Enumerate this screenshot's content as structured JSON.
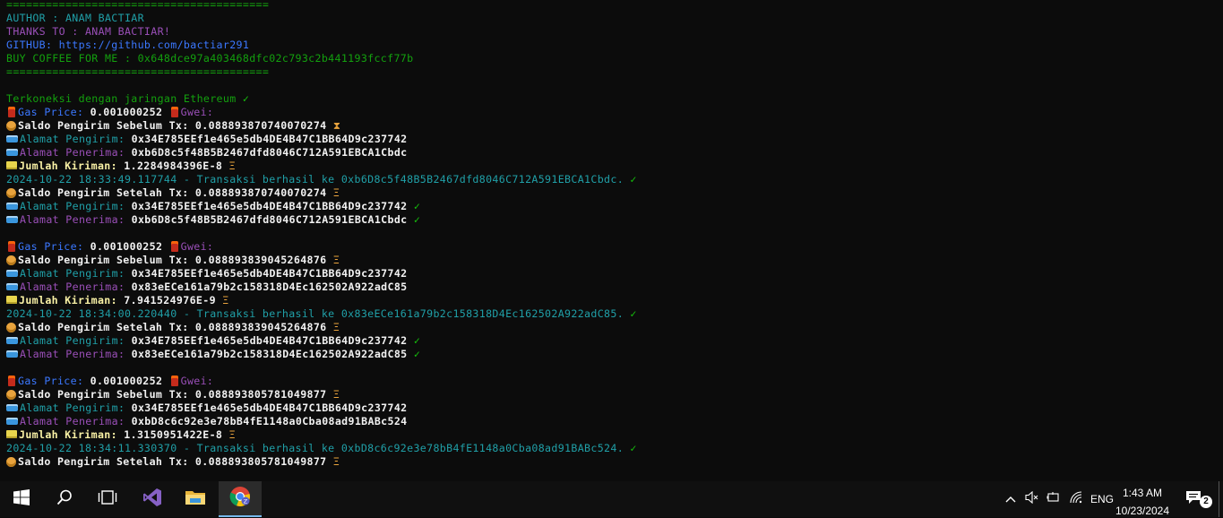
{
  "terminal": {
    "lines": [
      [
        {
          "t": "========================================",
          "c": "c-green"
        }
      ],
      [
        {
          "t": "AUTHOR : ANAM BACTIAR",
          "c": "c-teal"
        }
      ],
      [
        {
          "t": "THANKS TO : ANAM BACTIAR!",
          "c": "c-magenta"
        }
      ],
      [
        {
          "t": "GITHUB: https://github.com/bactiar291",
          "c": "c-blue"
        }
      ],
      [
        {
          "t": "BUY COFFEE FOR ME : 0x648dce97a403468dfc02c793c2b441193fccf77b",
          "c": "c-green"
        }
      ],
      [
        {
          "t": "========================================",
          "c": "c-green"
        }
      ],
      [],
      [
        {
          "t": "Terkoneksi dengan jaringan Ethereum ",
          "c": "c-green"
        },
        {
          "t": "✓",
          "c": "c-check"
        }
      ],
      [
        {
          "icon": "gas"
        },
        {
          "t": "Gas Price: ",
          "c": "c-blue"
        },
        {
          "t": "0.001000252 ",
          "c": "c-white"
        },
        {
          "icon": "gas"
        },
        {
          "t": "Gwei:",
          "c": "c-magenta"
        }
      ],
      [
        {
          "icon": "money"
        },
        {
          "t": "Saldo Pengirim Sebelum Tx: 0.088893870740070274 ",
          "c": "c-white"
        },
        {
          "t": "⧗",
          "c": "c-hour"
        }
      ],
      [
        {
          "icon": "wallet"
        },
        {
          "t": "Alamat Pengirim: ",
          "c": "c-teal"
        },
        {
          "t": "0x34E785EEf1e465e5db4DE4B47C1BB64D9c237742",
          "c": "c-white"
        }
      ],
      [
        {
          "icon": "wallet"
        },
        {
          "t": "Alamat Penerima: ",
          "c": "c-magenta"
        },
        {
          "t": "0xb6D8c5f48B5B2467dfd8046C712A591EBCA1Cbdc",
          "c": "c-white"
        }
      ],
      [
        {
          "icon": "sum"
        },
        {
          "t": "Jumlah Kiriman: ",
          "c": "c-yellow"
        },
        {
          "t": "1.2284984396E-8 ",
          "c": "c-white"
        },
        {
          "t": "Ξ",
          "c": "c-hour"
        }
      ],
      [
        {
          "t": "2024-10-22 18:33:49.117744 - Transaksi berhasil ke 0xb6D8c5f48B5B2467dfd8046C712A591EBCA1Cbdc. ",
          "c": "c-teal"
        },
        {
          "t": "✓",
          "c": "c-check"
        }
      ],
      [
        {
          "icon": "money"
        },
        {
          "t": "Saldo Pengirim Setelah Tx: 0.088893870740070274 ",
          "c": "c-white"
        },
        {
          "t": "Ξ",
          "c": "c-hour"
        }
      ],
      [
        {
          "icon": "wallet"
        },
        {
          "t": "Alamat Pengirim: ",
          "c": "c-teal"
        },
        {
          "t": "0x34E785EEf1e465e5db4DE4B47C1BB64D9c237742 ",
          "c": "c-white"
        },
        {
          "t": "✓",
          "c": "c-check"
        }
      ],
      [
        {
          "icon": "wallet"
        },
        {
          "t": "Alamat Penerima: ",
          "c": "c-magenta"
        },
        {
          "t": "0xb6D8c5f48B5B2467dfd8046C712A591EBCA1Cbdc ",
          "c": "c-white"
        },
        {
          "t": "✓",
          "c": "c-check"
        }
      ],
      [],
      [
        {
          "icon": "gas"
        },
        {
          "t": "Gas Price: ",
          "c": "c-blue"
        },
        {
          "t": "0.001000252 ",
          "c": "c-white"
        },
        {
          "icon": "gas"
        },
        {
          "t": "Gwei:",
          "c": "c-magenta"
        }
      ],
      [
        {
          "icon": "money"
        },
        {
          "t": "Saldo Pengirim Sebelum Tx: 0.088893839045264876 ",
          "c": "c-white"
        },
        {
          "t": "Ξ",
          "c": "c-hour"
        }
      ],
      [
        {
          "icon": "wallet"
        },
        {
          "t": "Alamat Pengirim: ",
          "c": "c-teal"
        },
        {
          "t": "0x34E785EEf1e465e5db4DE4B47C1BB64D9c237742",
          "c": "c-white"
        }
      ],
      [
        {
          "icon": "wallet"
        },
        {
          "t": "Alamat Penerima: ",
          "c": "c-magenta"
        },
        {
          "t": "0x83eECe161a79b2c158318D4Ec162502A922adC85",
          "c": "c-white"
        }
      ],
      [
        {
          "icon": "sum"
        },
        {
          "t": "Jumlah Kiriman: ",
          "c": "c-yellow"
        },
        {
          "t": "7.941524976E-9 ",
          "c": "c-white"
        },
        {
          "t": "Ξ",
          "c": "c-hour"
        }
      ],
      [
        {
          "t": "2024-10-22 18:34:00.220440 - Transaksi berhasil ke 0x83eECe161a79b2c158318D4Ec162502A922adC85. ",
          "c": "c-teal"
        },
        {
          "t": "✓",
          "c": "c-check"
        }
      ],
      [
        {
          "icon": "money"
        },
        {
          "t": "Saldo Pengirim Setelah Tx: 0.088893839045264876 ",
          "c": "c-white"
        },
        {
          "t": "Ξ",
          "c": "c-hour"
        }
      ],
      [
        {
          "icon": "wallet"
        },
        {
          "t": "Alamat Pengirim: ",
          "c": "c-teal"
        },
        {
          "t": "0x34E785EEf1e465e5db4DE4B47C1BB64D9c237742 ",
          "c": "c-white"
        },
        {
          "t": "✓",
          "c": "c-check"
        }
      ],
      [
        {
          "icon": "wallet"
        },
        {
          "t": "Alamat Penerima: ",
          "c": "c-magenta"
        },
        {
          "t": "0x83eECe161a79b2c158318D4Ec162502A922adC85 ",
          "c": "c-white"
        },
        {
          "t": "✓",
          "c": "c-check"
        }
      ],
      [],
      [
        {
          "icon": "gas"
        },
        {
          "t": "Gas Price: ",
          "c": "c-blue"
        },
        {
          "t": "0.001000252 ",
          "c": "c-white"
        },
        {
          "icon": "gas"
        },
        {
          "t": "Gwei:",
          "c": "c-magenta"
        }
      ],
      [
        {
          "icon": "money"
        },
        {
          "t": "Saldo Pengirim Sebelum Tx: 0.088893805781049877 ",
          "c": "c-white"
        },
        {
          "t": "Ξ",
          "c": "c-hour"
        }
      ],
      [
        {
          "icon": "wallet"
        },
        {
          "t": "Alamat Pengirim: ",
          "c": "c-teal"
        },
        {
          "t": "0x34E785EEf1e465e5db4DE4B47C1BB64D9c237742",
          "c": "c-white"
        }
      ],
      [
        {
          "icon": "wallet"
        },
        {
          "t": "Alamat Penerima: ",
          "c": "c-magenta"
        },
        {
          "t": "0xbD8c6c92e3e78bB4fE1148a0Cba08ad91BABc524",
          "c": "c-white"
        }
      ],
      [
        {
          "icon": "sum"
        },
        {
          "t": "Jumlah Kiriman: ",
          "c": "c-yellow"
        },
        {
          "t": "1.3150951422E-8 ",
          "c": "c-white"
        },
        {
          "t": "Ξ",
          "c": "c-hour"
        }
      ],
      [
        {
          "t": "2024-10-22 18:34:11.330370 - Transaksi berhasil ke 0xbD8c6c92e3e78bB4fE1148a0Cba08ad91BABc524. ",
          "c": "c-teal"
        },
        {
          "t": "✓",
          "c": "c-check"
        }
      ],
      [
        {
          "icon": "money"
        },
        {
          "t": "Saldo Pengirim Setelah Tx: 0.088893805781049877 ",
          "c": "c-white"
        },
        {
          "t": "Ξ",
          "c": "c-hour"
        }
      ]
    ]
  },
  "taskbar": {
    "colors": {
      "background": "#101010",
      "active_underline": "#76b9ed"
    },
    "apps": [
      {
        "name": "start-button",
        "icon": "windows-logo-icon"
      },
      {
        "name": "search-button",
        "icon": "search-icon"
      },
      {
        "name": "task-view-button",
        "icon": "task-view-icon"
      },
      {
        "name": "visual-studio-button",
        "icon": "visual-studio-icon"
      },
      {
        "name": "file-explorer-button",
        "icon": "folder-icon"
      },
      {
        "name": "chrome-button",
        "icon": "chrome-icon",
        "active": true
      }
    ],
    "tray": {
      "language": "ENG",
      "time": "1:43 AM",
      "date": "10/23/2024",
      "notification_count": "2"
    }
  }
}
